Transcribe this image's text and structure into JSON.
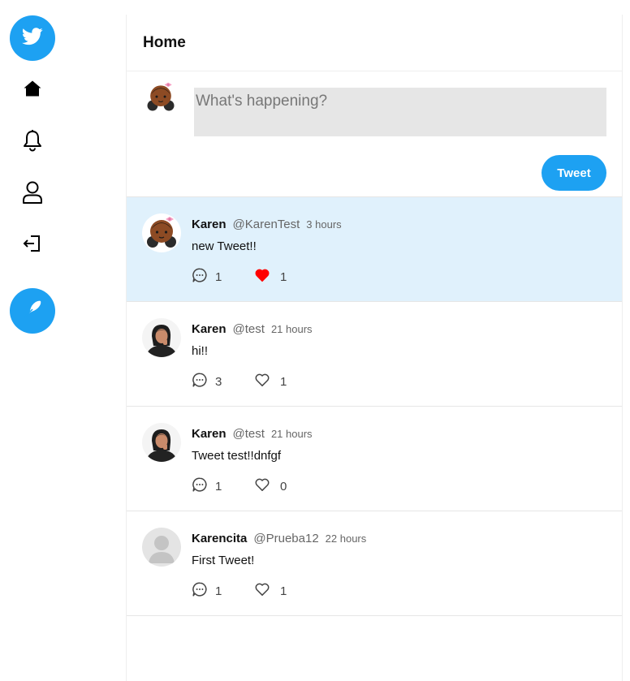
{
  "sidebar": {
    "items": [
      {
        "name": "logo",
        "icon": "twitter-bird-icon"
      },
      {
        "name": "home",
        "icon": "home-icon"
      },
      {
        "name": "notifications",
        "icon": "bell-icon"
      },
      {
        "name": "profile",
        "icon": "user-icon"
      },
      {
        "name": "logout",
        "icon": "logout-icon"
      },
      {
        "name": "compose",
        "icon": "feather-icon"
      }
    ],
    "accent": "#1da1f2"
  },
  "header": {
    "title": "Home"
  },
  "composer": {
    "placeholder": "What's happening?",
    "value": "",
    "button_label": "Tweet"
  },
  "tweets": [
    {
      "name": "Karen",
      "handle": "@KarenTest",
      "time": "3 hours",
      "text": "new Tweet!!",
      "replies": "1",
      "likes": "1",
      "liked": true,
      "highlighted": true,
      "avatar": "cartoon-girl-bow"
    },
    {
      "name": "Karen",
      "handle": "@test",
      "time": "21 hours",
      "text": "hi!!",
      "replies": "3",
      "likes": "1",
      "liked": false,
      "highlighted": false,
      "avatar": "photo-woman"
    },
    {
      "name": "Karen",
      "handle": "@test",
      "time": "21 hours",
      "text": "Tweet test!!dnfgf",
      "replies": "1",
      "likes": "0",
      "liked": false,
      "highlighted": false,
      "avatar": "photo-woman"
    },
    {
      "name": "Karencita",
      "handle": "@Prueba12",
      "time": "22 hours",
      "text": "First Tweet!",
      "replies": "1",
      "likes": "1",
      "liked": false,
      "highlighted": false,
      "avatar": "default-user"
    }
  ],
  "colors": {
    "liked_heart": "#ff0000",
    "highlight_bg": "#e0f1fc"
  }
}
